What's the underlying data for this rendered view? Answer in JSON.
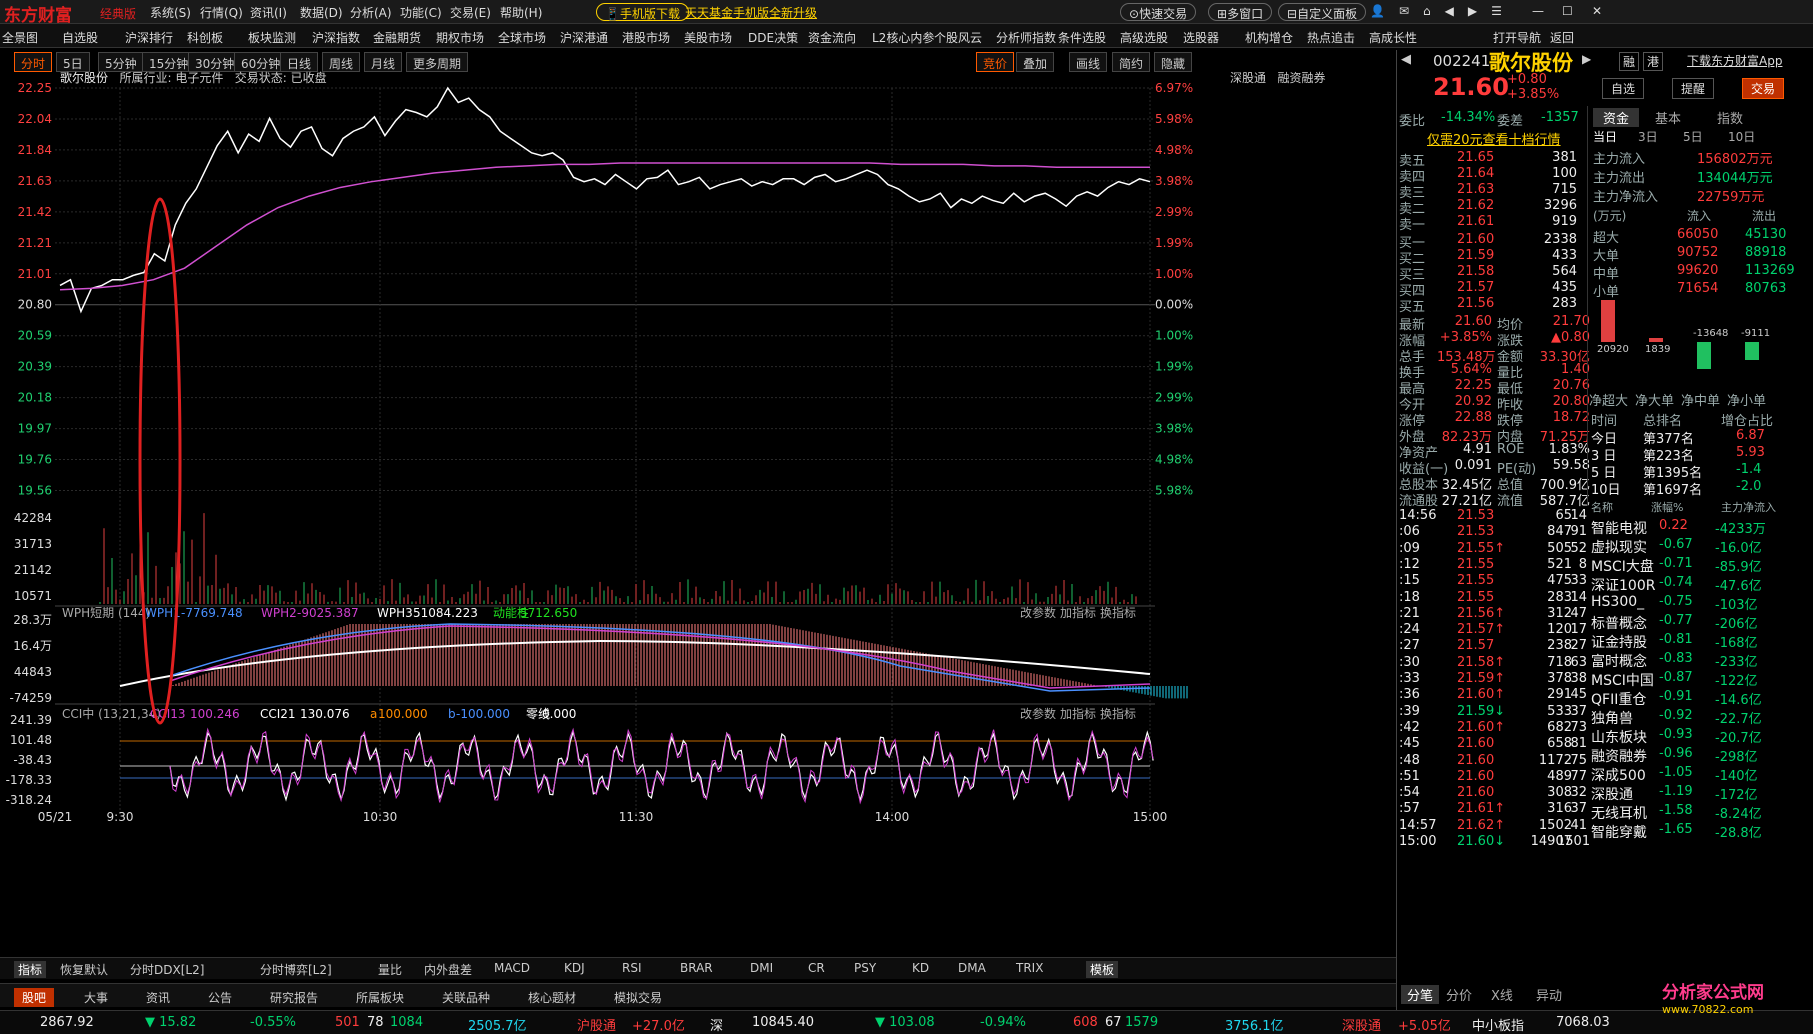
{
  "app": {
    "logo": "东方财富",
    "edition": "经典版",
    "menus": [
      "系统(S)",
      "行情(Q)",
      "资讯(I)",
      "数据(D)",
      "分析(A)",
      "功能(C)",
      "交易(E)",
      "帮助(H)"
    ],
    "mobile_btn": "手机版下载",
    "promo": "天天基金手机版全新升级",
    "quick_trade": "快速交易",
    "multi_window": "多窗口",
    "custom_panel": "自定义面板"
  },
  "nav": {
    "items": [
      "全景图",
      "自选股",
      "沪深排行",
      "科创板",
      "板块监测",
      "沪深指数",
      "金融期货",
      "期权市场",
      "全球市场",
      "沪深港通",
      "港股市场",
      "美股市场",
      "DDE决策",
      "资金流向",
      "L2核心内参",
      "个股风云",
      "分析师指数",
      "条件选股",
      "高级选股",
      "选股器",
      "机构增仓",
      "热点追击",
      "高成长性",
      "打开导航",
      "返回"
    ]
  },
  "periods": {
    "items": [
      "分时",
      "5日",
      "5分钟",
      "15分钟",
      "30分钟",
      "60分钟",
      "日线",
      "周线",
      "月线",
      "更多周期"
    ],
    "right": [
      "竞价",
      "叠加",
      "画线",
      "简约",
      "隐藏"
    ]
  },
  "chart_data": [
    {
      "type": "line",
      "title": "歌尔股份",
      "subtitle_items": [
        "所属行业: 电子元件",
        "交易状态: 已收盘"
      ],
      "top_right": [
        "深股通",
        "融资融券"
      ],
      "ylim": [
        19.35,
        22.25
      ],
      "yticks": [
        "22.25",
        "22.04",
        "21.84",
        "21.63",
        "21.42",
        "21.21",
        "21.01",
        "20.80",
        "20.59",
        "20.39",
        "20.18",
        "19.97",
        "19.76",
        "19.56"
      ],
      "pct_ticks": [
        "6.97%",
        "5.98%",
        "4.98%",
        "3.98%",
        "2.99%",
        "1.99%",
        "1.00%",
        "0.00%",
        "1.00%",
        "1.99%",
        "2.99%",
        "3.98%",
        "4.98%",
        "5.98%"
      ],
      "xticks": [
        "05/21",
        "9:30",
        "10:30",
        "11:30",
        "14:00",
        "15:00"
      ],
      "series": [
        {
          "name": "price",
          "color": "#ffffff",
          "values": [
            20.88,
            20.92,
            20.7,
            20.86,
            20.88,
            20.92,
            20.92,
            20.95,
            20.97,
            21.1,
            21.05,
            21.3,
            21.45,
            21.55,
            21.7,
            21.85,
            21.95,
            21.8,
            21.93,
            21.88,
            22.04,
            21.9,
            21.84,
            21.95,
            21.98,
            21.83,
            21.78,
            21.9,
            21.95,
            21.98,
            22.05,
            21.92,
            22.02,
            22.1,
            22.08,
            22.05,
            22.12,
            22.25,
            22.15,
            22.18,
            22.1,
            22.05,
            21.95,
            21.9,
            21.85,
            21.8,
            21.78,
            21.8,
            21.75,
            21.63,
            21.6,
            21.62,
            21.58,
            21.65,
            21.6,
            21.55,
            21.62,
            21.63,
            21.68,
            21.58,
            21.6,
            21.63,
            21.55,
            21.58,
            21.6,
            21.62,
            21.57,
            21.6,
            21.58,
            21.62,
            21.62,
            21.58,
            21.63,
            21.65,
            21.6,
            21.62,
            21.65,
            21.68,
            21.65,
            21.58,
            21.55,
            21.5,
            21.46,
            21.48,
            21.52,
            21.42,
            21.48,
            21.45,
            21.5,
            21.47,
            21.45,
            21.52,
            21.46,
            21.5,
            21.52,
            21.48,
            21.43,
            21.5,
            21.53,
            21.5,
            21.56,
            21.6,
            21.58,
            21.62,
            21.6
          ]
        },
        {
          "name": "avg",
          "color": "#d050d0",
          "values": [
            20.85,
            20.86,
            20.88,
            20.92,
            21.0,
            21.15,
            21.3,
            21.42,
            21.5,
            21.56,
            21.6,
            21.63,
            21.66,
            21.68,
            21.7,
            21.71,
            21.72,
            21.72,
            21.73,
            21.73,
            21.73,
            21.73,
            21.73,
            21.73,
            21.73,
            21.73,
            21.73,
            21.72,
            21.72,
            21.72,
            21.71,
            21.71,
            21.7,
            21.7,
            21.7,
            21.7
          ]
        }
      ],
      "volume_ticks": [
        "42284",
        "31713",
        "21142",
        "10571"
      ]
    },
    {
      "type": "bar",
      "title": "WPH短期 (144)",
      "series": [
        {
          "name": "WPH1",
          "value": "-7769.748",
          "color": "#4a90ff"
        },
        {
          "name": "WPH2",
          "value": "-9025.387",
          "color": "#d040d0"
        },
        {
          "name": "WPH3",
          "value": "51084.223",
          "color": "#ffffff"
        },
        {
          "name": "动能柱",
          "value": "5712.650",
          "color": "#20e020"
        }
      ],
      "yticks": [
        "28.3万",
        "16.4万",
        "44843",
        "-74259"
      ],
      "buttons": [
        "改参数",
        "加指标",
        "换指标"
      ]
    },
    {
      "type": "line",
      "title": "CCI中 (13,21,34)",
      "series": [
        {
          "name": "CCI13",
          "value": "100.246",
          "color": "#d040d0"
        },
        {
          "name": "CCI21",
          "value": "130.076",
          "color": "#ffffff"
        },
        {
          "name": "a",
          "value": "100.000",
          "color": "#ff8c00"
        },
        {
          "name": "b",
          "value": "-100.000",
          "color": "#4a90ff"
        },
        {
          "name": "零线",
          "value": "0.000",
          "color": "#ffffff"
        }
      ],
      "yticks": [
        "241.39",
        "101.48",
        "-38.43",
        "-178.33",
        "-318.24"
      ],
      "buttons": [
        "改参数",
        "加指标",
        "换指标"
      ]
    }
  ],
  "quote": {
    "code": "002241",
    "name": "歌尔股份",
    "price": "21.60",
    "change": "+0.80",
    "pct": "+3.85%",
    "btns": [
      "融",
      "港"
    ],
    "self": "自选",
    "remind": "提醒",
    "trade": "交易",
    "download": "下载东方财富App",
    "weibi_label": "委比",
    "weibi": "-14.34%",
    "weicha_label": "委差",
    "weicha": "-1357",
    "level10": "仅需20元查看十档行情"
  },
  "asks": [
    {
      "l": "卖五",
      "p": "21.65",
      "v": "381"
    },
    {
      "l": "卖四",
      "p": "21.64",
      "v": "100"
    },
    {
      "l": "卖三",
      "p": "21.63",
      "v": "715"
    },
    {
      "l": "卖二",
      "p": "21.62",
      "v": "3296"
    },
    {
      "l": "卖一",
      "p": "21.61",
      "v": "919"
    }
  ],
  "bids": [
    {
      "l": "买一",
      "p": "21.60",
      "v": "2338"
    },
    {
      "l": "买二",
      "p": "21.59",
      "v": "433"
    },
    {
      "l": "买三",
      "p": "21.58",
      "v": "564"
    },
    {
      "l": "买四",
      "p": "21.57",
      "v": "435"
    },
    {
      "l": "买五",
      "p": "21.56",
      "v": "283"
    }
  ],
  "stats": [
    [
      "最新",
      "21.60",
      "均价",
      "21.70"
    ],
    [
      "涨幅",
      "+3.85%",
      "涨跌",
      "▲0.80"
    ],
    [
      "总手",
      "153.48万",
      "金额",
      "33.30亿"
    ],
    [
      "换手",
      "5.64%",
      "量比",
      "1.40"
    ],
    [
      "最高",
      "22.25",
      "最低",
      "20.76"
    ],
    [
      "今开",
      "20.92",
      "昨收",
      "20.80"
    ],
    [
      "涨停",
      "22.88",
      "跌停",
      "18.72"
    ],
    [
      "外盘",
      "82.23万",
      "内盘",
      "71.25万"
    ],
    [
      "净资产",
      "4.91",
      "ROE",
      "1.83%"
    ],
    [
      "收益(一)",
      "0.091",
      "PE(动)",
      "59.58"
    ],
    [
      "总股本",
      "32.45亿",
      "总值",
      "700.9亿"
    ],
    [
      "流通股",
      "27.21亿",
      "流值",
      "587.7亿"
    ]
  ],
  "ticks": [
    [
      "14:56",
      "21.53",
      "65",
      "14"
    ],
    [
      ":06",
      "21.53",
      "847",
      "91"
    ],
    [
      ":09",
      "21.55↑",
      "505",
      "52"
    ],
    [
      ":12",
      "21.55",
      "521",
      "8"
    ],
    [
      ":15",
      "21.55",
      "475",
      "33"
    ],
    [
      ":18",
      "21.55",
      "283",
      "14"
    ],
    [
      ":21",
      "21.56↑",
      "312",
      "47"
    ],
    [
      ":24",
      "21.57↑",
      "120",
      "17"
    ],
    [
      ":27",
      "21.57",
      "238",
      "27"
    ],
    [
      ":30",
      "21.58↑",
      "718",
      "63"
    ],
    [
      ":33",
      "21.59↑",
      "378",
      "38"
    ],
    [
      ":36",
      "21.60↑",
      "291",
      "45"
    ],
    [
      ":39",
      "21.59↓",
      "533",
      "37"
    ],
    [
      ":42",
      "21.60↑",
      "682",
      "73"
    ],
    [
      ":45",
      "21.60",
      "658",
      "81"
    ],
    [
      ":48",
      "21.60",
      "1172",
      "75"
    ],
    [
      ":51",
      "21.60",
      "489",
      "77"
    ],
    [
      ":54",
      "21.60",
      "308",
      "32"
    ],
    [
      ":57",
      "21.61↑",
      "316",
      "37"
    ],
    [
      "14:57",
      "21.62↑",
      "1502",
      "41"
    ],
    [
      "15:00",
      "21.60↓",
      "14907",
      "1501"
    ]
  ],
  "fund": {
    "tabs": [
      "资金",
      "基本",
      "指数"
    ],
    "subtabs": [
      "当日",
      "3日",
      "5日",
      "10日"
    ],
    "flows": [
      [
        "主力流入",
        "156802万元"
      ],
      [
        "主力流出",
        "134044万元"
      ],
      [
        "主力净流入",
        "22759万元"
      ]
    ],
    "unit": "(万元)",
    "in": "流入",
    "out": "流出",
    "rows": [
      [
        "超大",
        "66050",
        "45130"
      ],
      [
        "大单",
        "90752",
        "88918"
      ],
      [
        "中单",
        "99620",
        "113269"
      ],
      [
        "小单",
        "71654",
        "80763"
      ]
    ],
    "bars": [
      {
        "v": 20920,
        "l": "20920"
      },
      {
        "v": 1839,
        "l": "1839"
      },
      {
        "v": -13648,
        "l": "-13648"
      },
      {
        "v": -9111,
        "l": "-9111"
      }
    ],
    "bar_labels": [
      "净超大",
      "净大单",
      "净中单",
      "净小单"
    ],
    "rank_head": [
      "时间",
      "总排名",
      "增仓占比"
    ],
    "ranks": [
      [
        "今日",
        "第377名",
        "6.87"
      ],
      [
        "3 日",
        "第223名",
        "5.93"
      ],
      [
        "5 日",
        "第1395名",
        "-1.4"
      ],
      [
        "10日",
        "第1697名",
        "-2.0"
      ]
    ],
    "sector_head": [
      "名称",
      "涨幅%",
      "主力净流入"
    ],
    "sectors": [
      [
        "智能电视",
        "0.22",
        "-4233万"
      ],
      [
        "虚拟现实",
        "-0.67",
        "-16.0亿"
      ],
      [
        "MSCI大盘",
        "-0.71",
        "-85.9亿"
      ],
      [
        "深证100R",
        "-0.74",
        "-47.6亿"
      ],
      [
        "HS300_",
        "-0.75",
        "-103亿"
      ],
      [
        "标普概念",
        "-0.77",
        "-206亿"
      ],
      [
        "证金持股",
        "-0.81",
        "-168亿"
      ],
      [
        "富时概念",
        "-0.83",
        "-233亿"
      ],
      [
        "MSCI中国",
        "-0.87",
        "-122亿"
      ],
      [
        "QFII重仓",
        "-0.91",
        "-14.6亿"
      ],
      [
        "独角兽",
        "-0.92",
        "-22.7亿"
      ],
      [
        "山东板块",
        "-0.93",
        "-20.7亿"
      ],
      [
        "融资融券",
        "-0.96",
        "-298亿"
      ],
      [
        "深成500",
        "-1.05",
        "-140亿"
      ],
      [
        "深股通",
        "-1.19",
        "-172亿"
      ],
      [
        "无线耳机",
        "-1.58",
        "-8.24亿"
      ],
      [
        "智能穿戴",
        "-1.65",
        "-28.8亿"
      ]
    ],
    "bottom_tabs": [
      "分笔",
      "分价",
      "X线",
      "异动"
    ]
  },
  "bottom_tabs": [
    "指标",
    "恢复默认",
    "分时DDX[L2]",
    "分时博弈[L2]",
    "量比",
    "内外盘差",
    "MACD",
    "KDJ",
    "RSI",
    "BRAR",
    "DMI",
    "CR",
    "PSY",
    "KD",
    "DMA",
    "TRIX",
    "模板"
  ],
  "news_tabs": [
    "股吧",
    "大事",
    "资讯",
    "公告",
    "研究报告",
    "所属板块",
    "关联品种",
    "核心题材",
    "模拟交易"
  ],
  "status": {
    "sh": "2867.92",
    "sh_chg": "▼ 15.82",
    "sh_pct": "-0.55%",
    "sh_up": "501",
    "sh_flat": "78",
    "sh_down": "1084",
    "sh_amt": "2505.7亿",
    "hgt_label": "沪股通",
    "hgt": "+27.0亿",
    "sz_label": "深",
    "sz": "10845.40",
    "sz_chg": "▼ 103.08",
    "sz_pct": "-0.94%",
    "sz_up": "608",
    "sz_flat": "67",
    "sz_down": "1579",
    "sz_amt": "3756.1亿",
    "sgt_label": "深股通",
    "sgt": "+5.05亿",
    "zxb_label": "中小板指",
    "zxb": "7068.03",
    "wm": "分析家公式网",
    "wm_url": "www.70822.com"
  }
}
